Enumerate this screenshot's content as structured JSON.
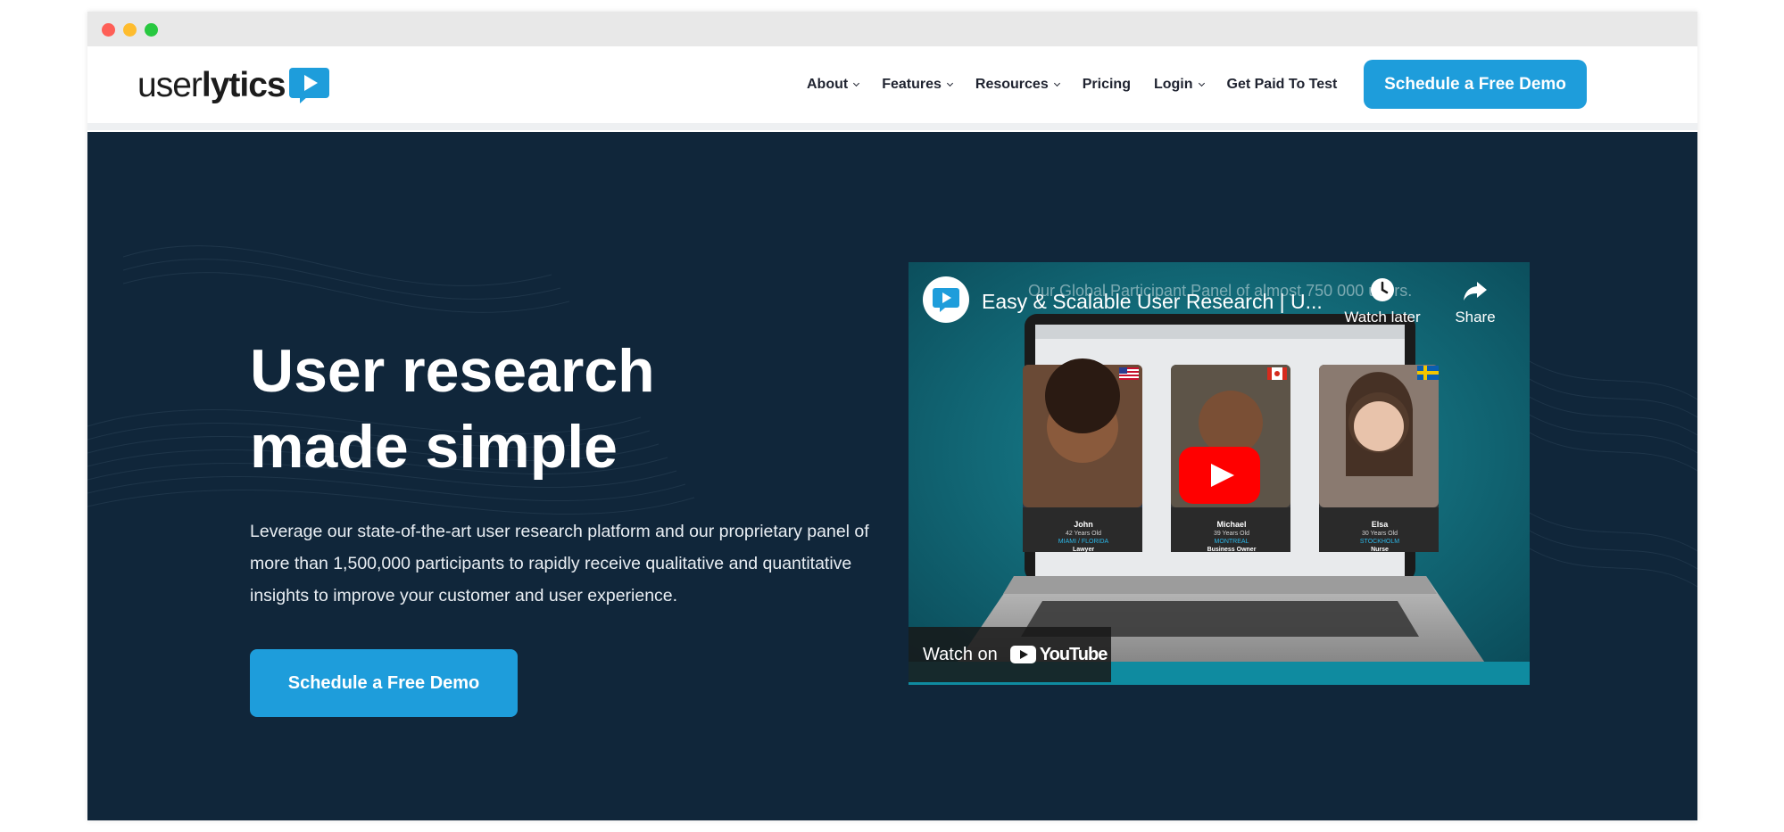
{
  "brand": {
    "logo_regular": "user",
    "logo_bold": "lytics",
    "accent": "#1e9ddb",
    "hero_bg": "#10263a"
  },
  "nav": {
    "items": [
      {
        "label": "About",
        "dropdown": true
      },
      {
        "label": "Features",
        "dropdown": true
      },
      {
        "label": "Resources",
        "dropdown": true
      },
      {
        "label": "Pricing",
        "dropdown": false
      },
      {
        "label": "Login",
        "dropdown": true
      },
      {
        "label": "Get Paid To Test",
        "dropdown": false
      }
    ],
    "cta_label": "Schedule a Free Demo"
  },
  "hero": {
    "title": "User research made simple",
    "description": "Leverage our state-of-the-art user research platform and our proprietary panel of more than 1,500,000 participants to rapidly receive qualitative and quantitative insights to improve your customer and user experience.",
    "cta_label": "Schedule a Free Demo"
  },
  "video": {
    "title": "Easy & Scalable User Research | U...",
    "overlay_subtitle": "Our Global Participant Panel of almost 750 000 users.",
    "watch_later_label": "Watch later",
    "share_label": "Share",
    "watch_on_label": "Watch on",
    "youtube_wordmark": "YouTube",
    "participants": [
      {
        "name": "John",
        "age": "42 Years Old",
        "city": "MIAMI / FLORIDA",
        "job": "Lawyer"
      },
      {
        "name": "Michael",
        "age": "39 Years Old",
        "city": "MONTREAL",
        "job": "Business Owner"
      },
      {
        "name": "Elsa",
        "age": "30 Years Old",
        "city": "STOCKHOLM",
        "job": "Nurse"
      }
    ]
  }
}
